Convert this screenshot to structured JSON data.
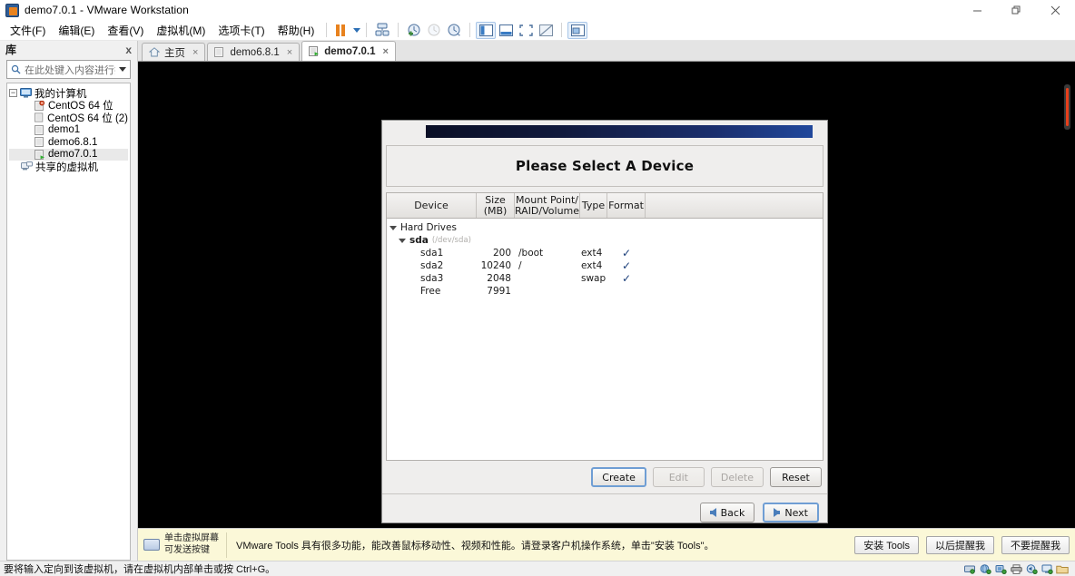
{
  "window": {
    "title": "demo7.0.1 - VMware Workstation",
    "app_icon": "vmware-icon",
    "controls": {
      "minimize": "minimize-icon",
      "restore": "restore-icon",
      "close": "close-icon"
    }
  },
  "menubar": {
    "items": [
      {
        "label": "文件(F)"
      },
      {
        "label": "编辑(E)"
      },
      {
        "label": "查看(V)"
      },
      {
        "label": "虚拟机(M)"
      },
      {
        "label": "选项卡(T)"
      },
      {
        "label": "帮助(H)"
      }
    ],
    "toolbar_icons": [
      "pause-icon",
      "dropdown-caret-icon",
      "send-ctrl-alt-del-icon",
      "take-snapshot-icon",
      "revert-snapshot-icon",
      "manage-snapshots-icon",
      "show-library-icon",
      "show-thumbnail-bar-icon",
      "full-screen-icon",
      "unity-mode-icon",
      "show-console-view-icon"
    ]
  },
  "library": {
    "header_title": "库",
    "close_label": "x",
    "search": {
      "placeholder": "在此处键入内容进行搜...",
      "value": "",
      "icon": "search-icon",
      "caret": "chevron-down-icon"
    },
    "tree": [
      {
        "label": "我的计算机",
        "level": 0,
        "icon": "my-computer-icon",
        "expander": "−",
        "selected": false
      },
      {
        "label": "CentOS 64 位",
        "level": 1,
        "icon": "vm-suspended-icon",
        "expander": "",
        "selected": false
      },
      {
        "label": "CentOS 64 位 (2)",
        "level": 1,
        "icon": "vm-powered-off-icon",
        "expander": "",
        "selected": false
      },
      {
        "label": "demo1",
        "level": 1,
        "icon": "vm-powered-off-icon",
        "expander": "",
        "selected": false
      },
      {
        "label": "demo6.8.1",
        "level": 1,
        "icon": "vm-powered-off-icon",
        "expander": "",
        "selected": false
      },
      {
        "label": "demo7.0.1",
        "level": 1,
        "icon": "vm-running-icon",
        "expander": "",
        "selected": true
      },
      {
        "label": "共享的虚拟机",
        "level": 0,
        "icon": "shared-vms-icon",
        "expander": "",
        "selected": false
      }
    ]
  },
  "tabs": [
    {
      "label": "主页",
      "icon": "home-icon",
      "active": false,
      "close": "×"
    },
    {
      "label": "demo6.8.1",
      "icon": "vm-powered-off-icon",
      "active": false,
      "close": "×"
    },
    {
      "label": "demo7.0.1",
      "icon": "vm-running-icon",
      "active": true,
      "close": "×"
    }
  ],
  "guest": {
    "dialog": {
      "title": "Please Select A Device",
      "banner_gradient_from": "#0a0f26",
      "banner_gradient_to": "#21489c",
      "table": {
        "columns": [
          {
            "key": "device",
            "label": "Device"
          },
          {
            "key": "size",
            "label": "Size\n(MB)",
            "line1": "Size",
            "line2": "(MB)"
          },
          {
            "key": "mount",
            "label": "Mount Point/\nRAID/Volume",
            "line1": "Mount Point/",
            "line2": "RAID/Volume"
          },
          {
            "key": "type",
            "label": "Type"
          },
          {
            "key": "format",
            "label": "Format"
          }
        ],
        "rows": [
          {
            "kind": "group",
            "indent": 0,
            "expander": "expanded-triangle-icon",
            "device": "Hard Drives",
            "device_path": "",
            "size": "",
            "mount": "",
            "type": "",
            "format": false
          },
          {
            "kind": "disk",
            "indent": 1,
            "expander": "expanded-triangle-icon",
            "device": "sda",
            "device_path": "(/dev/sda)",
            "size": "",
            "mount": "",
            "type": "",
            "format": false
          },
          {
            "kind": "partition",
            "indent": 2,
            "expander": "",
            "device": "sda1",
            "device_path": "",
            "size": "200",
            "mount": "/boot",
            "type": "ext4",
            "format": true
          },
          {
            "kind": "partition",
            "indent": 2,
            "expander": "",
            "device": "sda2",
            "device_path": "",
            "size": "10240",
            "mount": "/",
            "type": "ext4",
            "format": true
          },
          {
            "kind": "partition",
            "indent": 2,
            "expander": "",
            "device": "sda3",
            "device_path": "",
            "size": "2048",
            "mount": "",
            "type": "swap",
            "format": true
          },
          {
            "kind": "free",
            "indent": 2,
            "expander": "",
            "device": "Free",
            "device_path": "",
            "size": "7991",
            "mount": "",
            "type": "",
            "format": false
          }
        ],
        "format_check_glyph": "✓"
      },
      "action_buttons": [
        {
          "label": "Create",
          "enabled": true,
          "focused": true
        },
        {
          "label": "Edit",
          "enabled": false,
          "focused": false
        },
        {
          "label": "Delete",
          "enabled": false,
          "focused": false
        },
        {
          "label": "Reset",
          "enabled": true,
          "focused": false
        }
      ],
      "nav_buttons": [
        {
          "label": "Back",
          "icon": "arrow-left-icon",
          "focused": false
        },
        {
          "label": "Next",
          "icon": "arrow-right-icon",
          "focused": true
        }
      ]
    }
  },
  "tools_bar": {
    "hint_line1": "单击虚拟屏幕",
    "hint_line2": "可发送按键",
    "hint_icon": "keyboard-icon",
    "message": "VMware Tools 具有很多功能，能改善鼠标移动性、视频和性能。请登录客户机操作系统，单击\"安装 Tools\"。",
    "buttons": [
      {
        "label": "安装 Tools"
      },
      {
        "label": "以后提醒我"
      },
      {
        "label": "不要提醒我"
      }
    ]
  },
  "statusbar": {
    "message": "要将输入定向到该虚拟机，请在虚拟机内部单击或按 Ctrl+G。",
    "device_icons": [
      "hard-disk-icon",
      "network-adapter-icon",
      "usb-device-icon",
      "printer-icon",
      "sound-card-icon",
      "display-icon",
      "folder-sharing-icon"
    ]
  }
}
